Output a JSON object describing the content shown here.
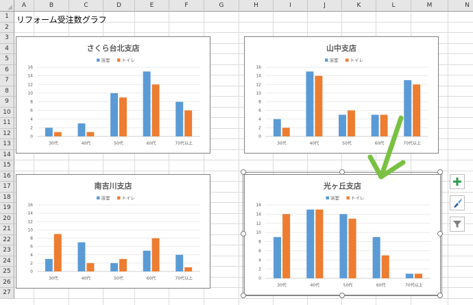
{
  "sheet": {
    "columns": [
      "A",
      "B",
      "C",
      "D",
      "E",
      "F",
      "G",
      "H",
      "I",
      "J",
      "K",
      "L",
      "M",
      "N"
    ],
    "rows": [
      "1",
      "2",
      "3",
      "4",
      "5",
      "6",
      "7",
      "8",
      "9",
      "10",
      "11",
      "12",
      "13",
      "14",
      "15",
      "16",
      "17",
      "18",
      "19",
      "20",
      "21",
      "22",
      "23",
      "24",
      "25",
      "26",
      "27"
    ],
    "a1_text": "リフォーム受注数グラフ"
  },
  "colors": {
    "bathroom": "#5b9bd5",
    "toilet": "#ed7d31",
    "arrow": "#7ac143"
  },
  "chart_data": [
    {
      "type": "bar",
      "title": "さくら台北支店",
      "categories": [
        "30代",
        "40代",
        "50代",
        "60代",
        "70代以上"
      ],
      "series": [
        {
          "name": "浴室",
          "values": [
            2,
            3,
            10,
            15,
            8
          ]
        },
        {
          "name": "トイレ",
          "values": [
            1,
            1,
            9,
            12,
            6
          ]
        }
      ],
      "ylim": [
        0,
        16
      ],
      "yticks": [
        0,
        2,
        4,
        6,
        8,
        10,
        12,
        14,
        16
      ],
      "legend": "top",
      "grid": true
    },
    {
      "type": "bar",
      "title": "山中支店",
      "categories": [
        "30代",
        "40代",
        "50代",
        "60代",
        "70代以上"
      ],
      "series": [
        {
          "name": "浴室",
          "values": [
            4,
            15,
            5,
            5,
            13
          ]
        },
        {
          "name": "トイレ",
          "values": [
            2,
            14,
            6,
            5,
            12
          ]
        }
      ],
      "ylim": [
        0,
        16
      ],
      "yticks": [
        0,
        2,
        4,
        6,
        8,
        10,
        12,
        14,
        16
      ],
      "legend": "top",
      "grid": true
    },
    {
      "type": "bar",
      "title": "南吉川支店",
      "categories": [
        "30代",
        "40代",
        "50代",
        "60代",
        "70代以上"
      ],
      "series": [
        {
          "name": "浴室",
          "values": [
            3,
            7,
            2,
            5,
            4
          ]
        },
        {
          "name": "トイレ",
          "values": [
            9,
            2,
            3,
            8,
            1
          ]
        }
      ],
      "ylim": [
        0,
        16
      ],
      "yticks": [
        0,
        2,
        4,
        6,
        8,
        10,
        12,
        14,
        16
      ],
      "legend": "top",
      "grid": true
    },
    {
      "type": "bar",
      "title": "光ヶ丘支店",
      "categories": [
        "30代",
        "40代",
        "50代",
        "60代",
        "70代以上"
      ],
      "series": [
        {
          "name": "浴室",
          "values": [
            9,
            15,
            14,
            9,
            1
          ]
        },
        {
          "name": "トイレ",
          "values": [
            14,
            15,
            13,
            5,
            1
          ]
        }
      ],
      "ylim": [
        0,
        16
      ],
      "yticks": [
        0,
        2,
        4,
        6,
        8,
        10,
        12,
        14,
        16
      ],
      "legend": "top",
      "grid": true,
      "selected": true
    }
  ],
  "side_buttons": {
    "icons": [
      "plus-icon",
      "brush-icon",
      "filter-icon"
    ]
  }
}
